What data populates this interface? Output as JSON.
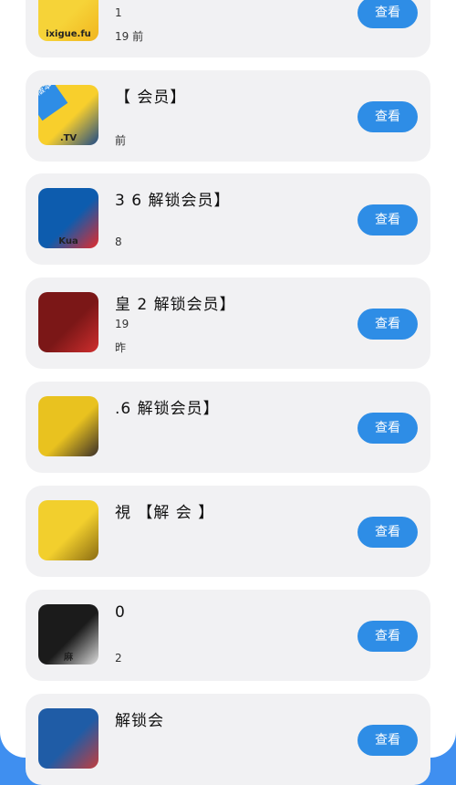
{
  "button_label": "查看",
  "items": [
    {
      "title": "",
      "meta1": "1",
      "meta2": "19    前",
      "icon_text": "ixigue.fu",
      "icon_name": "xigua-icon",
      "colors": [
        "#f6d338",
        "#f1b51f"
      ]
    },
    {
      "title": "【  会员】",
      "meta1": "",
      "meta2": "前",
      "icon_text": ".TV",
      "badge": "新版本",
      "icon_name": "thumb-icon",
      "colors": [
        "#f8cf2c",
        "#1e4a87"
      ]
    },
    {
      "title": "3  6  解锁会员】",
      "meta1": "",
      "meta2": "8",
      "icon_text": "Kua",
      "icon_name": "kuaiying-icon",
      "colors": [
        "#0d5cae",
        "#e42b2b"
      ]
    },
    {
      "title": "皇  2  解锁会员】",
      "meta1": "19",
      "meta2": "昨",
      "icon_text": "",
      "icon_name": "red-app-icon",
      "colors": [
        "#7b1717",
        "#cf2e2e"
      ]
    },
    {
      "title": ".6  解锁会员】",
      "meta1": "",
      "meta2": "",
      "icon_text": "",
      "icon_name": "portrait-icon",
      "colors": [
        "#e9c21f",
        "#3a2f28"
      ]
    },
    {
      "title": "視  【解  会  】",
      "meta1": "",
      "meta2": "",
      "icon_text": "",
      "icon_name": "yellow-app-icon",
      "colors": [
        "#f2cf2d",
        "#8a6b12"
      ]
    },
    {
      "title": "  0  ",
      "meta1": "",
      "meta2": "2",
      "icon_text": "麻",
      "icon_name": "black-app-icon",
      "colors": [
        "#1b1b1b",
        "#dcdcdc"
      ]
    },
    {
      "title": "解锁会",
      "meta1": "",
      "meta2": "",
      "icon_text": "",
      "icon_name": "blue-app-icon",
      "colors": [
        "#1f5ca6",
        "#c33d3d"
      ]
    }
  ]
}
